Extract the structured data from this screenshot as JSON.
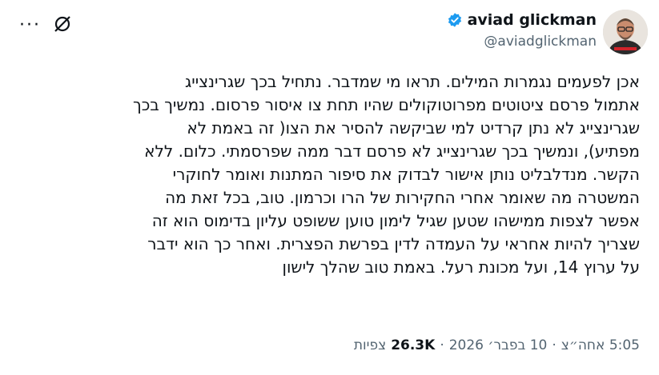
{
  "author": {
    "display_name": "aviad glickman",
    "handle": "@aviadglickman",
    "verified": true,
    "verified_color": "#1d9bf0"
  },
  "header_icons": [
    "more-icon",
    "grok-icon"
  ],
  "body": "אכן לפעמים נגמרות המילים. תראו מי שמדבר. נתחיל בכך שגרינצייג\nאתמול פרסם ציטוטים מפרוטוקולים שהיו תחת צו איסור פרסום. נמשיך בכך\nשגרינצייג לא נתן קרדיט למי שביקשה להסיר את הצו( זה באמת לא\nמפתיע), ונמשיך בכך שגרינצייג לא פרסם דבר ממה שפרסמתי. כלום. ללא\nהקשר. מנדלבליט נותן אישור לבדוק את סיפור המתנות ואומר לחוקרי\nהמשטרה מה שאומר אחרי החקירות של הרו וכרמון. טוב, בכל זאת מה\nאפשר לצפות ממישהו שטען שגיל לימון טוען ששופט עליון בדימוס הוא זה\nשצריך להיות אחראי על העמדה לדין בפרשת הפצרית. ואחר כך הוא ידבר\nעל ערוץ 14, ועל מכונת רעל. באמת טוב שהלך לישון",
  "meta": {
    "time": "5:05 אחה״צ",
    "separator": "·",
    "date": "10 בפבר׳ 2026",
    "views_count": "26.3K",
    "views_label": "צפיות"
  }
}
